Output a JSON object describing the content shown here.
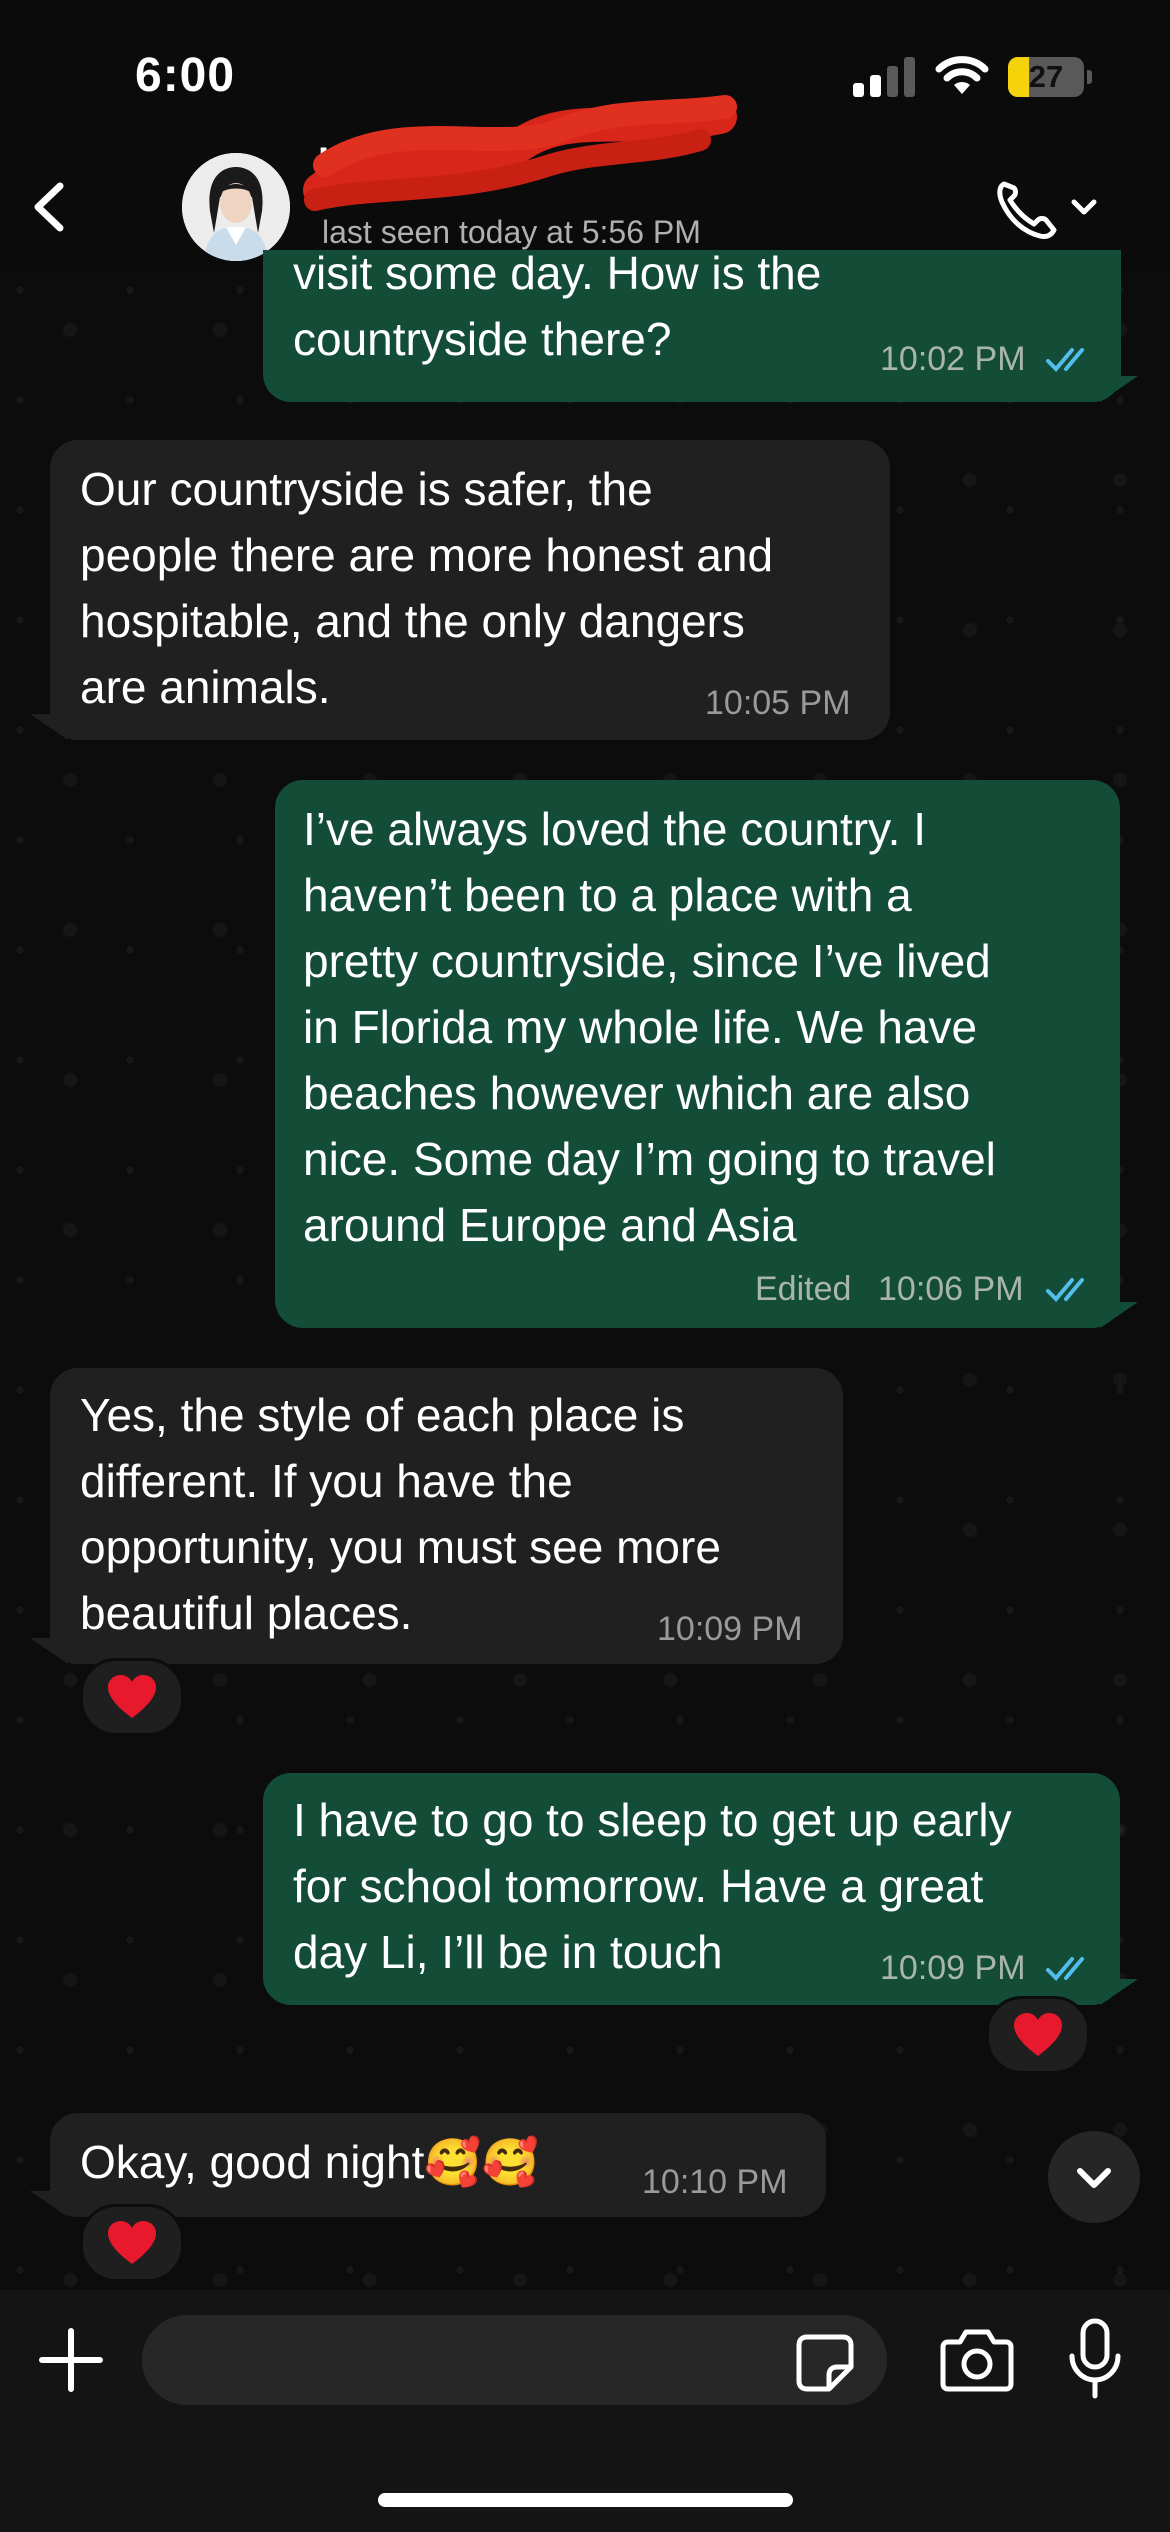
{
  "status_bar": {
    "time": "6:00",
    "battery": "27"
  },
  "header": {
    "contact_name": "Li",
    "last_seen": "last seen today at 5:56 PM"
  },
  "messages": [
    {
      "direction": "out",
      "lines": [
        "visit some day. How is the",
        "countryside there?"
      ],
      "time": "10:02 PM",
      "read": true
    },
    {
      "direction": "in",
      "lines": [
        "Our countryside is safer, the",
        "people there are more honest and",
        "hospitable, and the only dangers",
        "are animals."
      ],
      "time": "10:05 PM"
    },
    {
      "direction": "out",
      "lines": [
        "I’ve always loved the country. I",
        "haven’t been to a place with a",
        "pretty countryside, since I’ve lived",
        "in Florida my whole life. We have",
        "beaches however which are also",
        "nice. Some day I’m going to travel",
        "around Europe and Asia"
      ],
      "edited": "Edited",
      "time": "10:06 PM",
      "read": true
    },
    {
      "direction": "in",
      "lines": [
        "Yes, the style of each place is",
        "different. If you have the",
        "opportunity, you must see more",
        "beautiful places."
      ],
      "time": "10:09 PM",
      "reaction": "❤️"
    },
    {
      "direction": "out",
      "lines": [
        "I have to go to sleep to get up early",
        "for school tomorrow. Have a great",
        "day Li, I’ll be in touch"
      ],
      "time": "10:09 PM",
      "read": true,
      "reaction": "❤️"
    },
    {
      "direction": "in",
      "lines": [
        "Okay, good night🥰🥰"
      ],
      "time": "10:10 PM",
      "reaction": "❤️"
    }
  ],
  "composer": {
    "placeholder": ""
  },
  "colors": {
    "outgoing_bubble": "#134d37",
    "incoming_bubble": "#202020",
    "read_tick": "#53bdeb",
    "battery_fill": "#f5d30a"
  },
  "icons": [
    "back-chevron-icon",
    "phone-icon",
    "chevron-down-icon",
    "plus-icon",
    "sticker-icon",
    "camera-icon",
    "microphone-icon",
    "double-check-icon"
  ]
}
